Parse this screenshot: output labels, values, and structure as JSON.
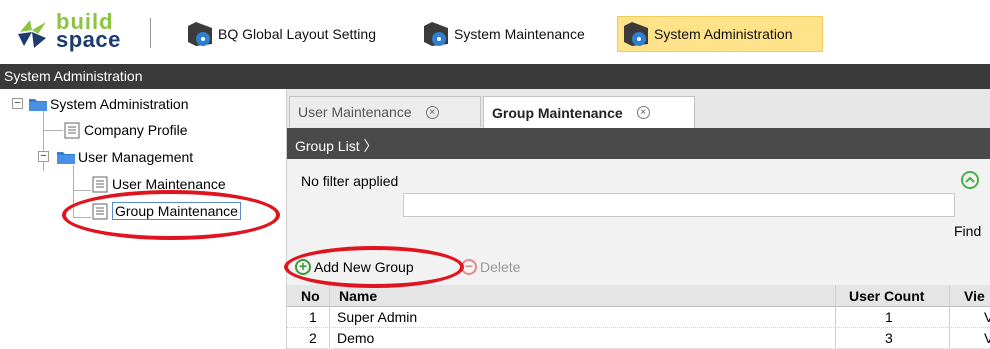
{
  "toolbar": {
    "logo_line1": "build",
    "logo_line2": "space",
    "buttons": [
      {
        "label": "BQ Global Layout Setting"
      },
      {
        "label": "System Maintenance"
      },
      {
        "label": "System Administration"
      }
    ]
  },
  "section_title": "System Administration",
  "tree": {
    "root": "System Administration",
    "company_profile": "Company Profile",
    "user_management": "User Management",
    "user_maintenance": "User Maintenance",
    "group_maintenance": "Group Maintenance"
  },
  "tabs": [
    {
      "label": "User Maintenance",
      "close": "⊗"
    },
    {
      "label": "Group Maintenance",
      "close": "⊗"
    }
  ],
  "group_list": {
    "title": "Group List",
    "chevron": "〉",
    "filter_text": "No filter applied",
    "filter_placeholder": "",
    "find_label": "Find",
    "add_label": "Add New Group",
    "delete_label": "Delete"
  },
  "table": {
    "headers": [
      "No",
      "Name",
      "User Count",
      "Vie"
    ],
    "rows": [
      {
        "no": "1",
        "name": "Super Admin",
        "count": "1",
        "view": "V"
      },
      {
        "no": "2",
        "name": "Demo",
        "count": "3",
        "view": "V"
      }
    ]
  },
  "colors": {
    "active_tab": "#ffe38a",
    "dark_header": "#3a3a3a",
    "highlight_ring": "#e0141e"
  }
}
